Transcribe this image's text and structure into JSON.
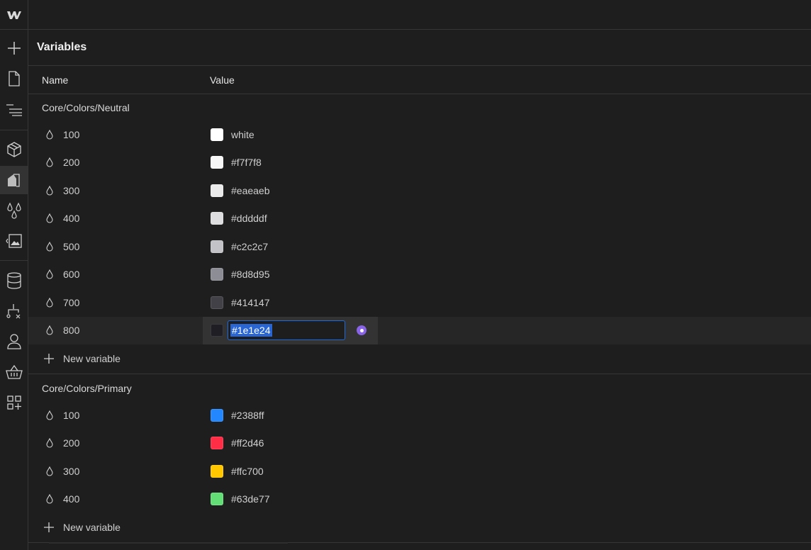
{
  "app": {
    "logo": "W"
  },
  "sidebar": {
    "icons": [
      {
        "name": "add-icon"
      },
      {
        "name": "page-icon"
      },
      {
        "name": "navigator-icon"
      },
      {
        "name": "components-icon"
      },
      {
        "name": "style-manager-icon",
        "active": true
      },
      {
        "name": "variables-icon"
      },
      {
        "name": "assets-icon"
      },
      {
        "name": "cms-icon"
      },
      {
        "name": "logic-icon"
      },
      {
        "name": "users-icon"
      },
      {
        "name": "ecommerce-icon"
      },
      {
        "name": "apps-icon"
      }
    ]
  },
  "panel": {
    "title": "Variables",
    "columns": {
      "name": "Name",
      "value": "Value"
    }
  },
  "groups": [
    {
      "title": "Core/Colors/Neutral",
      "rows": [
        {
          "name": "100",
          "value": "white",
          "color": "#ffffff"
        },
        {
          "name": "200",
          "value": "#f7f7f8",
          "color": "#f7f7f8"
        },
        {
          "name": "300",
          "value": "#eaeaeb",
          "color": "#eaeaeb"
        },
        {
          "name": "400",
          "value": "#dddddf",
          "color": "#dddddf"
        },
        {
          "name": "500",
          "value": "#c2c2c7",
          "color": "#c2c2c7"
        },
        {
          "name": "600",
          "value": "#8d8d95",
          "color": "#8d8d95"
        },
        {
          "name": "700",
          "value": "#414147",
          "color": "#414147"
        },
        {
          "name": "800",
          "value": "#1e1e24",
          "color": "#1e1e24",
          "editing": true
        }
      ],
      "new_label": "New variable"
    },
    {
      "title": "Core/Colors/Primary",
      "rows": [
        {
          "name": "100",
          "value": "#2388ff",
          "color": "#2388ff"
        },
        {
          "name": "200",
          "value": "#ff2d46",
          "color": "#ff2d46"
        },
        {
          "name": "300",
          "value": "#ffc700",
          "color": "#ffc700"
        },
        {
          "name": "400",
          "value": "#63de77",
          "color": "#63de77"
        }
      ],
      "new_label": "New variable"
    }
  ]
}
